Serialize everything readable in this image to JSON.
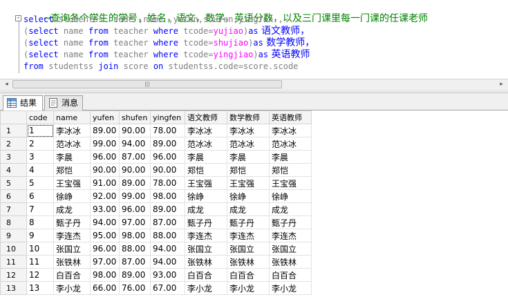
{
  "editor": {
    "collapse_glyph": "-",
    "comment": "--查询各个学生的学号，姓名，语文，数学，英语分数，以及三门课里每一门课的任课老师",
    "line1": {
      "kw": "select",
      "cols": " studentss. code ,name ,yufen,shufen,yingfen ,"
    },
    "line2": {
      "open": "(",
      "kw1": "select",
      "c1": " name ",
      "kw2": "from",
      "c2": " teacher ",
      "kw3": "where",
      "c3": " tcode=",
      "str": "yujiao",
      "close": ")",
      "kw4": "as",
      "alias": " 语文教师，"
    },
    "line3": {
      "open": "(",
      "kw1": "select",
      "c1": " name ",
      "kw2": "from",
      "c2": " teacher ",
      "kw3": "where",
      "c3": " tcode=",
      "str": "shujiao",
      "close": ")",
      "kw4": "as",
      "alias": " 数学教师，"
    },
    "line4": {
      "open": "(",
      "kw1": "select",
      "c1": " name ",
      "kw2": "from",
      "c2": " teacher ",
      "kw3": "where",
      "c3": " tcode=",
      "str": "yingjiao",
      "close": ")",
      "kw4": "as",
      "alias": " 英语教师"
    },
    "line5": {
      "kw1": "from",
      "c1": " studentss ",
      "kw2": "join",
      "c2": " score ",
      "kw3": "on",
      "c3": " studentss.code=score.scode"
    }
  },
  "scrollbar": {
    "left_arrow": "◂",
    "right_arrow": "▸",
    "grip": "|||"
  },
  "tabs": {
    "results": "结果",
    "messages": "消息"
  },
  "grid": {
    "columns": [
      "code",
      "name",
      "yufen",
      "shufen",
      "yingfen",
      "语文教师",
      "数学教师",
      "英语教师"
    ],
    "rows": [
      [
        "1",
        "1",
        "李冰冰",
        "89.00",
        "90.00",
        "78.00",
        "李冰冰",
        "李冰冰",
        "李冰冰"
      ],
      [
        "2",
        "2",
        "范冰冰",
        "99.00",
        "94.00",
        "89.00",
        "范冰冰",
        "范冰冰",
        "范冰冰"
      ],
      [
        "3",
        "3",
        "李晨",
        "96.00",
        "87.00",
        "96.00",
        "李晨",
        "李晨",
        "李晨"
      ],
      [
        "4",
        "4",
        "郑恺",
        "90.00",
        "90.00",
        "90.00",
        "郑恺",
        "郑恺",
        "郑恺"
      ],
      [
        "5",
        "5",
        "王宝强",
        "91.00",
        "89.00",
        "78.00",
        "王宝强",
        "王宝强",
        "王宝强"
      ],
      [
        "6",
        "6",
        "徐峥",
        "92.00",
        "99.00",
        "98.00",
        "徐峥",
        "徐峥",
        "徐峥"
      ],
      [
        "7",
        "7",
        "成龙",
        "93.00",
        "96.00",
        "89.00",
        "成龙",
        "成龙",
        "成龙"
      ],
      [
        "8",
        "8",
        "甄子丹",
        "94.00",
        "97.00",
        "87.00",
        "甄子丹",
        "甄子丹",
        "甄子丹"
      ],
      [
        "9",
        "9",
        "李连杰",
        "95.00",
        "98.00",
        "88.00",
        "李连杰",
        "李连杰",
        "李连杰"
      ],
      [
        "10",
        "10",
        "张国立",
        "96.00",
        "88.00",
        "94.00",
        "张国立",
        "张国立",
        "张国立"
      ],
      [
        "11",
        "11",
        "张铁林",
        "97.00",
        "87.00",
        "94.00",
        "张铁林",
        "张铁林",
        "张铁林"
      ],
      [
        "12",
        "12",
        "白百合",
        "98.00",
        "89.00",
        "93.00",
        "白百合",
        "白百合",
        "白百合"
      ],
      [
        "13",
        "13",
        "李小龙",
        "66.00",
        "76.00",
        "67.00",
        "李小龙",
        "李小龙",
        "李小龙"
      ]
    ]
  }
}
